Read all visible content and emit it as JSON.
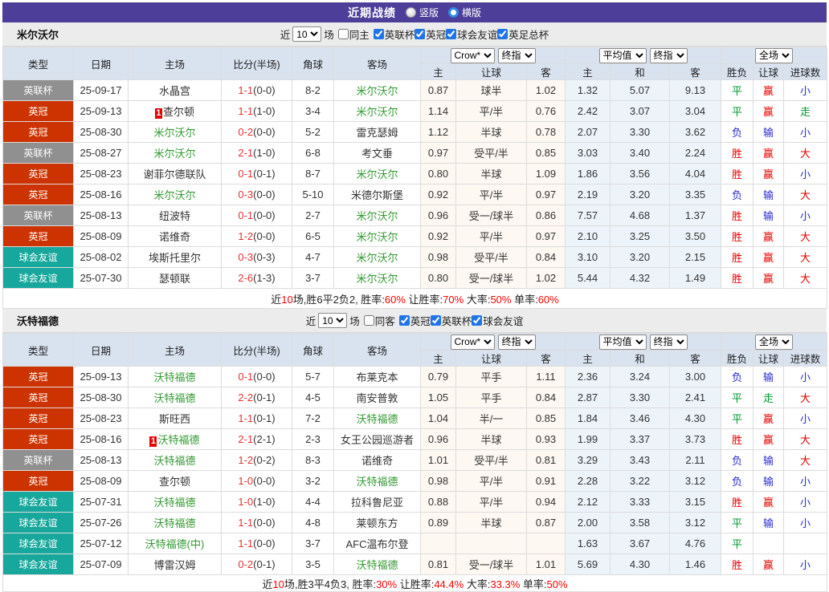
{
  "titlebar": {
    "title": "近期战绩",
    "layout_vertical": "竖版",
    "layout_horizontal": "横版"
  },
  "labels": {
    "near": "近",
    "field": "场"
  },
  "colors": {
    "topbar_purple": "#4c3e99",
    "badge_gray": "#909090",
    "badge_red": "#cc3300",
    "badge_teal": "#17a79c",
    "team_green": "#339933",
    "score_red": "#e63232",
    "win_red": "#e60000",
    "lose_blue": "#2b2bd0",
    "draw_green": "#009933",
    "header_blue": "#d9e3f0",
    "ah_bg": "#fdf8f1",
    "eu_bg": "#ecf4fa"
  },
  "table_header": {
    "col_type": "类型",
    "col_date": "日期",
    "col_home": "主场",
    "col_score": "比分(半场)",
    "col_corner": "角球",
    "col_away": "客场",
    "dd_company": "Crow*",
    "dd_stage1": "终指",
    "dd_avg": "平均值",
    "dd_stage2": "终指",
    "dd_scope": "全场",
    "sub_home": "主",
    "sub_handicap": "让球",
    "sub_away": "客",
    "sub_ehome": "主",
    "sub_draw": "和",
    "sub_eaway": "客",
    "sub_wdl": "胜负",
    "sub_hresult": "让球",
    "sub_goals": "进球数"
  },
  "sections": [
    {
      "team": "米尔沃尔",
      "filters": {
        "count": "10",
        "same": "同主",
        "competitions": [
          "英联杯",
          "英冠",
          "球会友谊",
          "英足总杯"
        ]
      },
      "rows": [
        {
          "type": "英联杯",
          "badge": "gray",
          "date": "25-09-17",
          "home": "水晶宫",
          "home_green": false,
          "home_card": "",
          "score": "1-1",
          "half": "(0-0)",
          "corners": "8-2",
          "away": "米尔沃尔",
          "away_green": true,
          "ah_home": "0.87",
          "ah_line": "球半",
          "ah_away": "1.02",
          "eu_home": "1.32",
          "eu_draw": "5.07",
          "eu_away": "9.13",
          "r1": {
            "t": "平",
            "c": "green"
          },
          "r2": {
            "t": "赢",
            "c": "red"
          },
          "r3": {
            "t": "小",
            "c": "blue"
          }
        },
        {
          "type": "英冠",
          "badge": "red",
          "date": "25-09-13",
          "home": "查尔顿",
          "home_green": false,
          "home_card": "1",
          "score": "1-1",
          "half": "(1-0)",
          "corners": "3-4",
          "away": "米尔沃尔",
          "away_green": true,
          "ah_home": "1.14",
          "ah_line": "平/半",
          "ah_away": "0.76",
          "eu_home": "2.42",
          "eu_draw": "3.07",
          "eu_away": "3.04",
          "r1": {
            "t": "平",
            "c": "green"
          },
          "r2": {
            "t": "赢",
            "c": "red"
          },
          "r3": {
            "t": "走",
            "c": "green"
          }
        },
        {
          "type": "英冠",
          "badge": "red",
          "date": "25-08-30",
          "home": "米尔沃尔",
          "home_green": true,
          "home_card": "",
          "score": "0-2",
          "half": "(0-0)",
          "corners": "5-2",
          "away": "雷克瑟姆",
          "away_green": false,
          "ah_home": "1.12",
          "ah_line": "半球",
          "ah_away": "0.78",
          "eu_home": "2.07",
          "eu_draw": "3.30",
          "eu_away": "3.62",
          "r1": {
            "t": "负",
            "c": "blue"
          },
          "r2": {
            "t": "输",
            "c": "blue"
          },
          "r3": {
            "t": "小",
            "c": "blue"
          }
        },
        {
          "type": "英联杯",
          "badge": "gray",
          "date": "25-08-27",
          "home": "米尔沃尔",
          "home_green": true,
          "home_card": "",
          "score": "2-1",
          "half": "(1-0)",
          "corners": "6-8",
          "away": "考文垂",
          "away_green": false,
          "ah_home": "0.97",
          "ah_line": "受平/半",
          "ah_away": "0.85",
          "eu_home": "3.03",
          "eu_draw": "3.40",
          "eu_away": "2.24",
          "r1": {
            "t": "胜",
            "c": "red"
          },
          "r2": {
            "t": "赢",
            "c": "red"
          },
          "r3": {
            "t": "大",
            "c": "red"
          }
        },
        {
          "type": "英冠",
          "badge": "red",
          "date": "25-08-23",
          "home": "谢菲尔德联队",
          "home_green": false,
          "home_card": "",
          "score": "0-1",
          "half": "(0-1)",
          "corners": "8-7",
          "away": "米尔沃尔",
          "away_green": true,
          "ah_home": "0.80",
          "ah_line": "半球",
          "ah_away": "1.09",
          "eu_home": "1.86",
          "eu_draw": "3.56",
          "eu_away": "4.04",
          "r1": {
            "t": "胜",
            "c": "red"
          },
          "r2": {
            "t": "赢",
            "c": "red"
          },
          "r3": {
            "t": "小",
            "c": "blue"
          }
        },
        {
          "type": "英冠",
          "badge": "red",
          "date": "25-08-16",
          "home": "米尔沃尔",
          "home_green": true,
          "home_card": "",
          "score": "0-3",
          "half": "(0-0)",
          "corners": "5-10",
          "away": "米德尔斯堡",
          "away_green": false,
          "ah_home": "0.92",
          "ah_line": "平/半",
          "ah_away": "0.97",
          "eu_home": "2.19",
          "eu_draw": "3.20",
          "eu_away": "3.35",
          "r1": {
            "t": "负",
            "c": "blue"
          },
          "r2": {
            "t": "输",
            "c": "blue"
          },
          "r3": {
            "t": "大",
            "c": "red"
          }
        },
        {
          "type": "英联杯",
          "badge": "gray",
          "date": "25-08-13",
          "home": "纽波特",
          "home_green": false,
          "home_card": "",
          "score": "0-1",
          "half": "(0-0)",
          "corners": "2-7",
          "away": "米尔沃尔",
          "away_green": true,
          "ah_home": "0.96",
          "ah_line": "受一/球半",
          "ah_away": "0.86",
          "eu_home": "7.57",
          "eu_draw": "4.68",
          "eu_away": "1.37",
          "r1": {
            "t": "胜",
            "c": "red"
          },
          "r2": {
            "t": "输",
            "c": "blue"
          },
          "r3": {
            "t": "小",
            "c": "blue"
          }
        },
        {
          "type": "英冠",
          "badge": "red",
          "date": "25-08-09",
          "home": "诺维奇",
          "home_green": false,
          "home_card": "",
          "score": "1-2",
          "half": "(0-0)",
          "corners": "6-5",
          "away": "米尔沃尔",
          "away_green": true,
          "ah_home": "0.92",
          "ah_line": "平/半",
          "ah_away": "0.97",
          "eu_home": "2.10",
          "eu_draw": "3.25",
          "eu_away": "3.50",
          "r1": {
            "t": "胜",
            "c": "red"
          },
          "r2": {
            "t": "赢",
            "c": "red"
          },
          "r3": {
            "t": "大",
            "c": "red"
          }
        },
        {
          "type": "球会友谊",
          "badge": "teal",
          "date": "25-08-02",
          "home": "埃斯托里尔",
          "home_green": false,
          "home_card": "",
          "score": "0-3",
          "half": "(0-3)",
          "corners": "4-7",
          "away": "米尔沃尔",
          "away_green": true,
          "ah_home": "0.98",
          "ah_line": "受平/半",
          "ah_away": "0.84",
          "eu_home": "3.10",
          "eu_draw": "3.20",
          "eu_away": "2.15",
          "r1": {
            "t": "胜",
            "c": "red"
          },
          "r2": {
            "t": "赢",
            "c": "red"
          },
          "r3": {
            "t": "大",
            "c": "red"
          }
        },
        {
          "type": "球会友谊",
          "badge": "teal",
          "date": "25-07-30",
          "home": "瑟顿联",
          "home_green": false,
          "home_card": "",
          "score": "2-6",
          "half": "(1-3)",
          "corners": "3-7",
          "away": "米尔沃尔",
          "away_green": true,
          "ah_home": "0.80",
          "ah_line": "受一/球半",
          "ah_away": "1.02",
          "eu_home": "5.44",
          "eu_draw": "4.32",
          "eu_away": "1.49",
          "r1": {
            "t": "胜",
            "c": "red"
          },
          "r2": {
            "t": "赢",
            "c": "red"
          },
          "r3": {
            "t": "大",
            "c": "red"
          }
        }
      ],
      "summary_parts": [
        {
          "text": "近",
          "red": false
        },
        {
          "text": "10",
          "red": true
        },
        {
          "text": "场,胜6平2负2, 胜率:",
          "red": false
        },
        {
          "text": "60%",
          "red": true
        },
        {
          "text": " 让胜率:",
          "red": false
        },
        {
          "text": "70%",
          "red": true
        },
        {
          "text": " 大率:",
          "red": false
        },
        {
          "text": "50%",
          "red": true
        },
        {
          "text": " 单率:",
          "red": false
        },
        {
          "text": "60%",
          "red": true
        }
      ]
    },
    {
      "team": "沃特福德",
      "filters": {
        "count": "10",
        "same": "同客",
        "competitions": [
          "英冠",
          "英联杯",
          "球会友谊"
        ]
      },
      "rows": [
        {
          "type": "英冠",
          "badge": "red",
          "date": "25-09-13",
          "home": "沃特福德",
          "home_green": true,
          "home_card": "",
          "score": "0-1",
          "half": "(0-0)",
          "corners": "5-7",
          "away": "布莱克本",
          "away_green": false,
          "ah_home": "0.79",
          "ah_line": "平手",
          "ah_away": "1.11",
          "eu_home": "2.36",
          "eu_draw": "3.24",
          "eu_away": "3.00",
          "r1": {
            "t": "负",
            "c": "blue"
          },
          "r2": {
            "t": "输",
            "c": "blue"
          },
          "r3": {
            "t": "小",
            "c": "blue"
          }
        },
        {
          "type": "英冠",
          "badge": "red",
          "date": "25-08-30",
          "home": "沃特福德",
          "home_green": true,
          "home_card": "",
          "score": "2-2",
          "half": "(0-1)",
          "corners": "4-5",
          "away": "南安普敦",
          "away_green": false,
          "ah_home": "1.05",
          "ah_line": "平手",
          "ah_away": "0.84",
          "eu_home": "2.87",
          "eu_draw": "3.30",
          "eu_away": "2.41",
          "r1": {
            "t": "平",
            "c": "green"
          },
          "r2": {
            "t": "走",
            "c": "green"
          },
          "r3": {
            "t": "大",
            "c": "red"
          }
        },
        {
          "type": "英冠",
          "badge": "red",
          "date": "25-08-23",
          "home": "斯旺西",
          "home_green": false,
          "home_card": "",
          "score": "1-1",
          "half": "(0-1)",
          "corners": "7-2",
          "away": "沃特福德",
          "away_green": true,
          "ah_home": "1.04",
          "ah_line": "半/一",
          "ah_away": "0.85",
          "eu_home": "1.84",
          "eu_draw": "3.46",
          "eu_away": "4.30",
          "r1": {
            "t": "平",
            "c": "green"
          },
          "r2": {
            "t": "赢",
            "c": "red"
          },
          "r3": {
            "t": "小",
            "c": "blue"
          }
        },
        {
          "type": "英冠",
          "badge": "red",
          "date": "25-08-16",
          "home": "沃特福德",
          "home_green": true,
          "home_card": "1",
          "score": "2-1",
          "half": "(2-1)",
          "corners": "2-3",
          "away": "女王公园巡游者",
          "away_green": false,
          "ah_home": "0.96",
          "ah_line": "半球",
          "ah_away": "0.93",
          "eu_home": "1.99",
          "eu_draw": "3.37",
          "eu_away": "3.73",
          "r1": {
            "t": "胜",
            "c": "red"
          },
          "r2": {
            "t": "赢",
            "c": "red"
          },
          "r3": {
            "t": "大",
            "c": "red"
          }
        },
        {
          "type": "英联杯",
          "badge": "gray",
          "date": "25-08-13",
          "home": "沃特福德",
          "home_green": true,
          "home_card": "",
          "score": "1-2",
          "half": "(0-2)",
          "corners": "8-3",
          "away": "诺维奇",
          "away_green": false,
          "ah_home": "1.01",
          "ah_line": "受平/半",
          "ah_away": "0.81",
          "eu_home": "3.29",
          "eu_draw": "3.43",
          "eu_away": "2.11",
          "r1": {
            "t": "负",
            "c": "blue"
          },
          "r2": {
            "t": "输",
            "c": "blue"
          },
          "r3": {
            "t": "大",
            "c": "red"
          }
        },
        {
          "type": "英冠",
          "badge": "red",
          "date": "25-08-09",
          "home": "查尔顿",
          "home_green": false,
          "home_card": "",
          "score": "1-0",
          "half": "(0-0)",
          "corners": "3-2",
          "away": "沃特福德",
          "away_green": true,
          "ah_home": "0.98",
          "ah_line": "平/半",
          "ah_away": "0.91",
          "eu_home": "2.28",
          "eu_draw": "3.22",
          "eu_away": "3.12",
          "r1": {
            "t": "负",
            "c": "blue"
          },
          "r2": {
            "t": "输",
            "c": "blue"
          },
          "r3": {
            "t": "小",
            "c": "blue"
          }
        },
        {
          "type": "球会友谊",
          "badge": "teal",
          "date": "25-07-31",
          "home": "沃特福德",
          "home_green": true,
          "home_card": "",
          "score": "1-0",
          "half": "(1-0)",
          "corners": "4-4",
          "away": "拉科鲁尼亚",
          "away_green": false,
          "ah_home": "0.88",
          "ah_line": "平/半",
          "ah_away": "0.94",
          "eu_home": "2.12",
          "eu_draw": "3.33",
          "eu_away": "3.15",
          "r1": {
            "t": "胜",
            "c": "red"
          },
          "r2": {
            "t": "赢",
            "c": "red"
          },
          "r3": {
            "t": "小",
            "c": "blue"
          }
        },
        {
          "type": "球会友谊",
          "badge": "teal",
          "date": "25-07-26",
          "home": "沃特福德",
          "home_green": true,
          "home_card": "",
          "score": "1-1",
          "half": "(0-0)",
          "corners": "4-8",
          "away": "莱顿东方",
          "away_green": false,
          "ah_home": "0.89",
          "ah_line": "半球",
          "ah_away": "0.87",
          "eu_home": "2.00",
          "eu_draw": "3.58",
          "eu_away": "3.12",
          "r1": {
            "t": "平",
            "c": "green"
          },
          "r2": {
            "t": "输",
            "c": "blue"
          },
          "r3": {
            "t": "小",
            "c": "blue"
          }
        },
        {
          "type": "球会友谊",
          "badge": "teal",
          "date": "25-07-12",
          "home": "沃特福德(中)",
          "home_green": true,
          "home_card": "",
          "score": "1-1",
          "half": "(0-0)",
          "corners": "3-7",
          "away": "AFC温布尔登",
          "away_green": false,
          "ah_home": "",
          "ah_line": "",
          "ah_away": "",
          "eu_home": "1.63",
          "eu_draw": "3.67",
          "eu_away": "4.76",
          "r1": {
            "t": "平",
            "c": "green"
          },
          "r2": {
            "t": "",
            "c": ""
          },
          "r3": {
            "t": "",
            "c": ""
          }
        },
        {
          "type": "球会友谊",
          "badge": "teal",
          "date": "25-07-09",
          "home": "博雷汉姆",
          "home_green": false,
          "home_card": "",
          "score": "0-2",
          "half": "(0-1)",
          "corners": "3-5",
          "away": "沃特福德",
          "away_green": true,
          "ah_home": "0.81",
          "ah_line": "受一/球半",
          "ah_away": "1.01",
          "eu_home": "5.69",
          "eu_draw": "4.30",
          "eu_away": "1.46",
          "r1": {
            "t": "胜",
            "c": "red"
          },
          "r2": {
            "t": "赢",
            "c": "red"
          },
          "r3": {
            "t": "小",
            "c": "blue"
          }
        }
      ],
      "summary_parts": [
        {
          "text": "近",
          "red": false
        },
        {
          "text": "10",
          "red": true
        },
        {
          "text": "场,胜3平4负3, 胜率:",
          "red": false
        },
        {
          "text": "30%",
          "red": true
        },
        {
          "text": " 让胜率:",
          "red": false
        },
        {
          "text": "44.4%",
          "red": true
        },
        {
          "text": " 大率:",
          "red": false
        },
        {
          "text": "33.3%",
          "red": true
        },
        {
          "text": " 单率:",
          "red": false
        },
        {
          "text": "50%",
          "red": true
        }
      ]
    }
  ]
}
